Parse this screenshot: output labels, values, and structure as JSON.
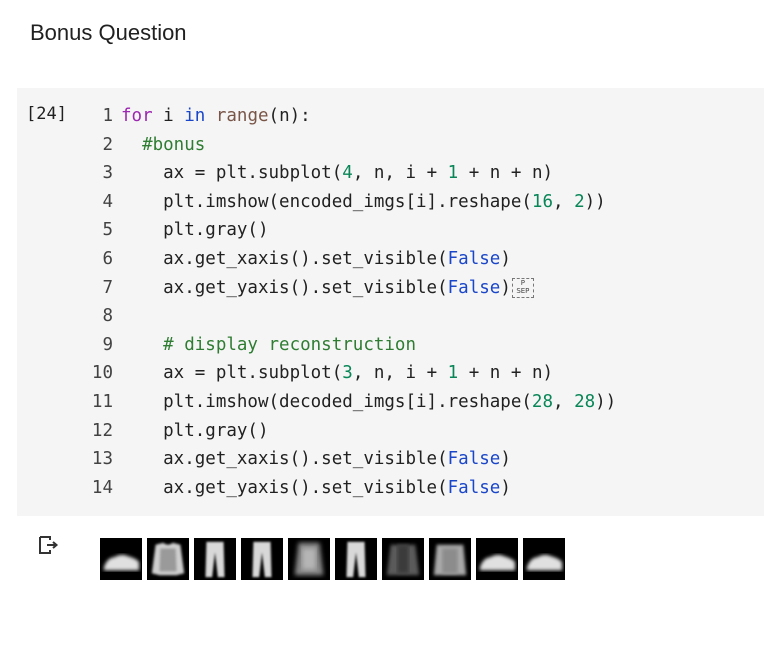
{
  "heading": "Bonus Question",
  "cell": {
    "execution_count": "[24]",
    "lines": [
      {
        "n": "1",
        "tokens": [
          [
            "kw",
            "for"
          ],
          [
            "",
            "i"
          ],
          [
            "kw2",
            "in"
          ],
          [
            "fn",
            "range"
          ],
          [
            "",
            "(n):"
          ]
        ]
      },
      {
        "n": "2",
        "tokens": [
          [
            "cm",
            "  #bonus"
          ]
        ]
      },
      {
        "n": "3",
        "tokens": [
          [
            "",
            "    ax = plt.subplot("
          ],
          [
            "num",
            "4"
          ],
          [
            "",
            ", n, i + "
          ],
          [
            "num",
            "1"
          ],
          [
            "",
            " + n + n)"
          ]
        ]
      },
      {
        "n": "4",
        "tokens": [
          [
            "",
            "    plt.imshow(encoded_imgs[i].reshape("
          ],
          [
            "num",
            "16"
          ],
          [
            "",
            ", "
          ],
          [
            "num",
            "2"
          ],
          [
            "",
            "))"
          ]
        ]
      },
      {
        "n": "5",
        "tokens": [
          [
            "",
            "    plt.gray()"
          ]
        ]
      },
      {
        "n": "6",
        "tokens": [
          [
            "",
            "    ax.get_xaxis().set_visible("
          ],
          [
            "bool",
            "False"
          ],
          [
            "",
            ")"
          ]
        ]
      },
      {
        "n": "7",
        "tokens": [
          [
            "",
            "    ax.get_yaxis().set_visible("
          ],
          [
            "bool",
            "False"
          ],
          [
            "",
            ")"
          ],
          [
            "sep",
            "P SEP"
          ]
        ]
      },
      {
        "n": "8",
        "tokens": []
      },
      {
        "n": "9",
        "tokens": [
          [
            "cm",
            "    # display reconstruction"
          ]
        ]
      },
      {
        "n": "10",
        "tokens": [
          [
            "",
            "    ax = plt.subplot("
          ],
          [
            "num",
            "3"
          ],
          [
            "",
            ", n, i + "
          ],
          [
            "num",
            "1"
          ],
          [
            "",
            " + n + n)"
          ]
        ]
      },
      {
        "n": "11",
        "tokens": [
          [
            "",
            "    plt.imshow(decoded_imgs[i].reshape("
          ],
          [
            "num",
            "28"
          ],
          [
            "",
            ", "
          ],
          [
            "num",
            "28"
          ],
          [
            "",
            "))"
          ]
        ]
      },
      {
        "n": "12",
        "tokens": [
          [
            "",
            "    plt.gray()"
          ]
        ]
      },
      {
        "n": "13",
        "tokens": [
          [
            "",
            "    ax.get_xaxis().set_visible("
          ],
          [
            "bool",
            "False"
          ],
          [
            "",
            ")"
          ]
        ]
      },
      {
        "n": "14",
        "tokens": [
          [
            "",
            "    ax.get_yaxis().set_visible("
          ],
          [
            "bool",
            "False"
          ],
          [
            "",
            ")"
          ]
        ]
      }
    ]
  },
  "output": {
    "icon": "output-arrow-icon",
    "images": [
      {
        "kind": "shoe"
      },
      {
        "kind": "shirt"
      },
      {
        "kind": "trousers"
      },
      {
        "kind": "trousers"
      },
      {
        "kind": "dress-blur"
      },
      {
        "kind": "trousers"
      },
      {
        "kind": "pullover-dark"
      },
      {
        "kind": "pullover"
      },
      {
        "kind": "shoe"
      },
      {
        "kind": "shoe"
      }
    ]
  }
}
